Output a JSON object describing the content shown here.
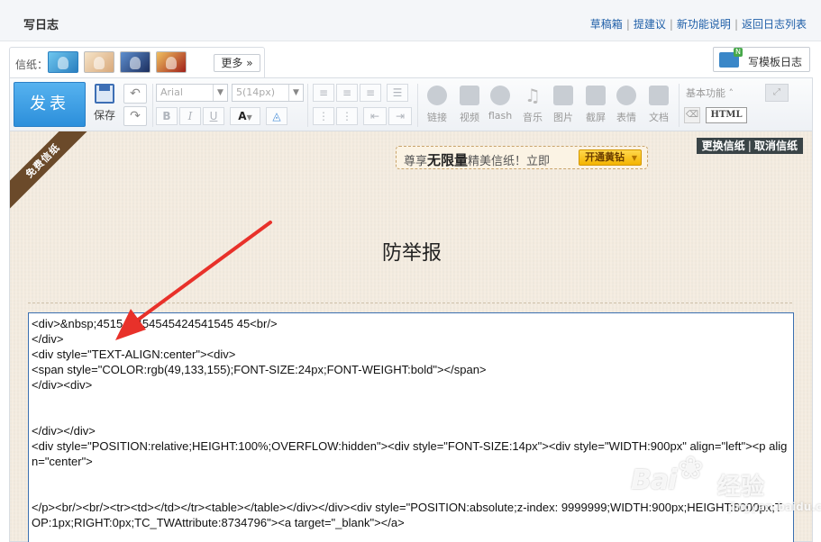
{
  "header": {
    "title": "写日志",
    "links": [
      "草稿箱",
      "提建议",
      "新功能说明",
      "返回日志列表"
    ]
  },
  "stationery": {
    "label": "信纸：",
    "more": "更多",
    "more_icon": "chevron-down-icon"
  },
  "template_button": {
    "label": "写模板日志"
  },
  "toolbar": {
    "publish": "发表",
    "save": "保存",
    "font_family": "Arial",
    "font_size": "5(14px)",
    "bold": "B",
    "italic": "I",
    "underline": "U",
    "font_color": "A",
    "media": [
      {
        "label": "链接",
        "icon": "link-icon"
      },
      {
        "label": "视频",
        "icon": "video-icon"
      },
      {
        "label": "flash",
        "icon": "flash-icon"
      },
      {
        "label": "音乐",
        "icon": "music-icon"
      },
      {
        "label": "图片",
        "icon": "image-icon"
      },
      {
        "label": "截屏",
        "icon": "screenshot-icon"
      },
      {
        "label": "表情",
        "icon": "emoji-icon"
      },
      {
        "label": "文档",
        "icon": "word-doc-icon"
      }
    ],
    "basic": "基本功能",
    "html": "HTML"
  },
  "editor": {
    "ribbon": "免费信纸",
    "promo": {
      "pre": "尊享",
      "big": "无限量",
      "post": "精美信纸！立即",
      "button": "开通黄钻"
    },
    "change_paper": "更换信纸",
    "cancel_paper": "取消信纸",
    "title": "防举报",
    "code_lines": [
      "<div>&nbsp;451545454545424541545 45<br/>",
      "</div>",
      "<div style=\"TEXT-ALIGN:center\"><div>",
      "<span style=\"COLOR:rgb(49,133,155);FONT-SIZE:24px;FONT-WEIGHT:bold\"></span>",
      "</div><div>",
      "",
      "",
      "</div></div>",
      "<div style=\"POSITION:relative;HEIGHT:100%;OVERFLOW:hidden\"><div style=\"FONT-SIZE:14px\"><div style=\"WIDTH:900px\" align=\"left\"><p align=\"center\">",
      "",
      "",
      "</p><br/><br/><tr><td></td></tr><table></table></div></div><div style=\"POSITION:absolute;z-index: 9999999;WIDTH:900px;HEIGHT:8000px;TOP:1px;RIGHT:0px;TC_TWAttribute:8734796\"><a target=\"_blank\"></a>"
    ]
  },
  "watermark": {
    "brand": "Bai",
    "cn": "经验",
    "url": "jingyan.baidu.com"
  },
  "colors": {
    "publish": "#2c8fdb",
    "link": "#1f5fa8",
    "paper": "#f4ece0",
    "arrow": "#e8312a"
  }
}
